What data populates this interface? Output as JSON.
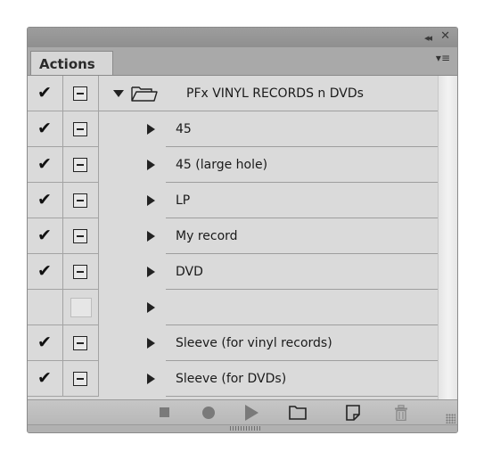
{
  "window": {
    "collapse_label": "◂◂",
    "close_label": "✕"
  },
  "tab": {
    "label": "Actions",
    "menu_label": "▾≡"
  },
  "check_glyph": "✔",
  "set": {
    "name": "PFx VINYL RECORDS n DVDs",
    "enabled": true,
    "dialog": true,
    "expanded": true
  },
  "actions": [
    {
      "name": "45",
      "enabled": true,
      "dialog": true
    },
    {
      "name": "45 (large hole)",
      "enabled": true,
      "dialog": true
    },
    {
      "name": "LP",
      "enabled": true,
      "dialog": true
    },
    {
      "name": "My record",
      "enabled": true,
      "dialog": true
    },
    {
      "name": "DVD",
      "enabled": true,
      "dialog": true
    },
    {
      "name": "",
      "enabled": false,
      "dialog": false
    },
    {
      "name": "Sleeve (for vinyl records)",
      "enabled": true,
      "dialog": true
    },
    {
      "name": "Sleeve (for DVDs)",
      "enabled": true,
      "dialog": true
    }
  ],
  "toolbar": {
    "buttons": [
      "stop-icon",
      "record-icon",
      "play-icon",
      "new-set-icon",
      "new-action-icon",
      "trash-icon"
    ],
    "icon_color": "#7a7a7a"
  }
}
